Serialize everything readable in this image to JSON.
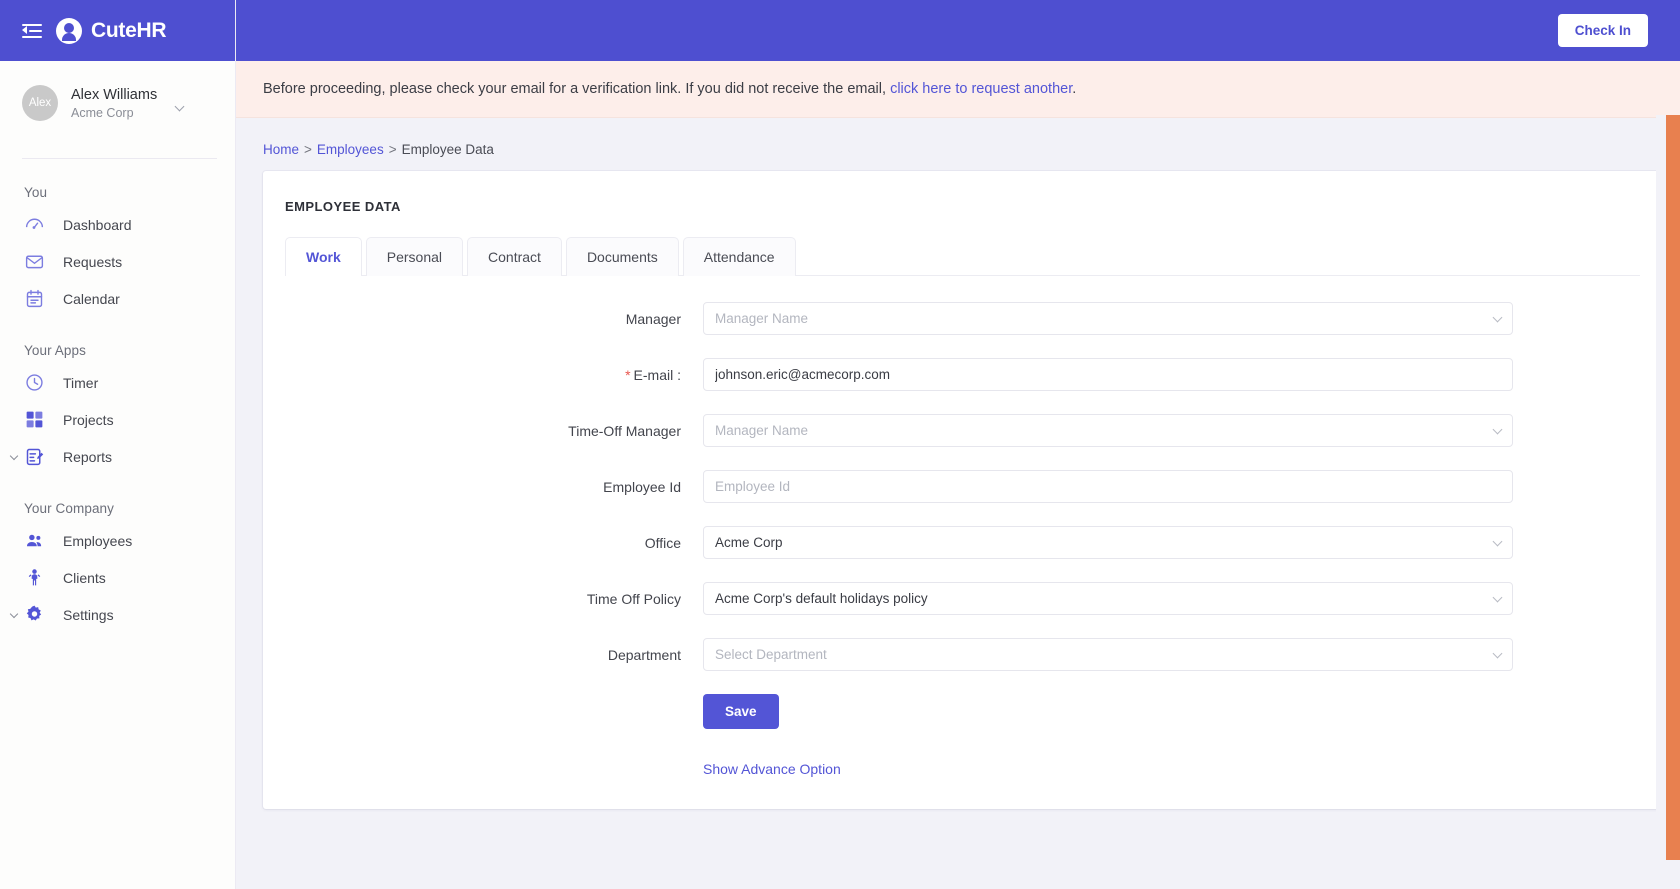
{
  "colors": {
    "brand_purple": "#4e4fd0",
    "accent_link": "#5355d6",
    "banner_bg": "#fdeeea",
    "required_red": "#e9564f",
    "orange_scroll": "#e8804f",
    "page_bg": "#f2f2f8"
  },
  "sidebar": {
    "hamburger_icon": "menu-collapse-icon",
    "brand": {
      "name": "CuteHR",
      "logo_icon": "cutehr-logo-icon"
    },
    "profile": {
      "avatar_initials": "Alex",
      "name": "Alex Williams",
      "org": "Acme Corp",
      "chevron_icon": "chevron-down-icon"
    },
    "groups": [
      {
        "label": "You",
        "items": [
          {
            "label": "Dashboard",
            "icon": "dashboard-gauge-icon",
            "expandable": false
          },
          {
            "label": "Requests",
            "icon": "envelope-icon",
            "expandable": false
          },
          {
            "label": "Calendar",
            "icon": "calendar-icon",
            "expandable": false
          }
        ]
      },
      {
        "label": "Your Apps",
        "items": [
          {
            "label": "Timer",
            "icon": "clock-icon",
            "expandable": false
          },
          {
            "label": "Projects",
            "icon": "grid-squares-icon",
            "expandable": false
          },
          {
            "label": "Reports",
            "icon": "report-edit-icon",
            "expandable": true
          }
        ]
      },
      {
        "label": "Your Company",
        "items": [
          {
            "label": "Employees",
            "icon": "people-group-icon",
            "expandable": false
          },
          {
            "label": "Clients",
            "icon": "person-raised-arms-icon",
            "expandable": false
          },
          {
            "label": "Settings",
            "icon": "gear-icon",
            "expandable": true
          }
        ]
      }
    ]
  },
  "topbar": {
    "checkin_label": "Check In"
  },
  "banner": {
    "text_before": "Before proceeding, please check your email for a verification link. If you did not receive the email, ",
    "link_text": "click here to request another",
    "text_after": "."
  },
  "breadcrumb": {
    "home": "Home",
    "employees": "Employees",
    "current": "Employee Data",
    "separator": ">"
  },
  "card": {
    "title": "EMPLOYEE DATA",
    "tabs": [
      {
        "label": "Work",
        "active": true
      },
      {
        "label": "Personal",
        "active": false
      },
      {
        "label": "Contract",
        "active": false
      },
      {
        "label": "Documents",
        "active": false
      },
      {
        "label": "Attendance",
        "active": false
      }
    ],
    "fields": [
      {
        "label": "Manager",
        "required": false,
        "type": "select",
        "value": "",
        "placeholder": "Manager Name"
      },
      {
        "label": "E-mail :",
        "required": true,
        "type": "text",
        "value": "johnson.eric@acmecorp.com",
        "placeholder": ""
      },
      {
        "label": "Time-Off Manager",
        "required": false,
        "type": "select",
        "value": "",
        "placeholder": "Manager Name"
      },
      {
        "label": "Employee Id",
        "required": false,
        "type": "text",
        "value": "",
        "placeholder": "Employee Id"
      },
      {
        "label": "Office",
        "required": false,
        "type": "select",
        "value": "Acme Corp",
        "placeholder": ""
      },
      {
        "label": "Time Off Policy",
        "required": false,
        "type": "select",
        "value": "Acme Corp's default holidays policy",
        "placeholder": ""
      },
      {
        "label": "Department",
        "required": false,
        "type": "select",
        "value": "",
        "placeholder": "Select Department"
      }
    ],
    "save_label": "Save",
    "advance_option_label": "Show Advance Option"
  }
}
